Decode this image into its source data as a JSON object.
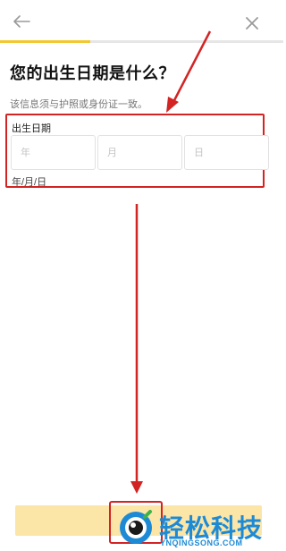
{
  "header": {
    "back_icon": "arrow-left-icon",
    "close_icon": "close-x-icon",
    "progress_fraction": 0.32
  },
  "title": "您的出生日期是什么？",
  "subtitle": "该信息须与护照或身份证一致。",
  "dob": {
    "label": "出生日期",
    "year_placeholder": "年",
    "month_placeholder": "月",
    "day_placeholder": "日",
    "format_hint": "年/月/日"
  },
  "continue_button": {
    "label": ""
  },
  "watermark": {
    "brand": "轻松科技",
    "domain": "YNQINGSONG.COM"
  },
  "colors": {
    "accent": "#f2c832",
    "button_disabled": "#fbe6a8",
    "annotation_red": "#d32424",
    "watermark_blue": "#1d8ad6"
  }
}
